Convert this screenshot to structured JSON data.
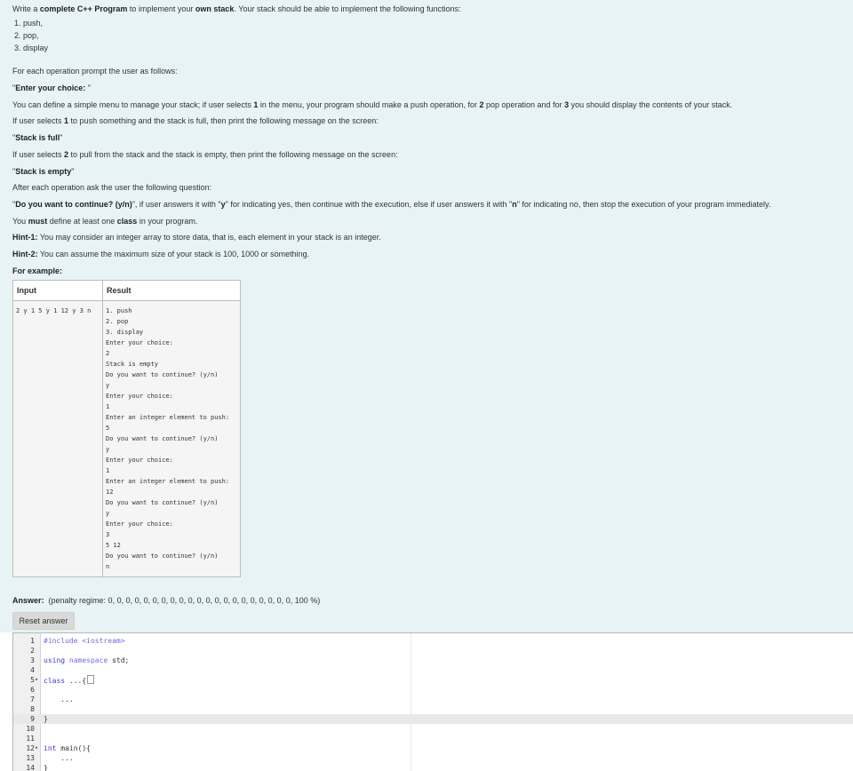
{
  "question": {
    "intro": {
      "pre": "Write a ",
      "b1": "complete C++ Program",
      "mid": " to implement your ",
      "b2": "own stack",
      "post": ". Your stack should be able to implement the following functions:"
    },
    "functions": [
      "1. push,",
      "2. pop,",
      "3. display"
    ],
    "prompt_line": "For each operation prompt the user as follows:",
    "enter_choice": {
      "q1": "\"",
      "b": "Enter your choice: ",
      "q2": "\""
    },
    "menu_desc": {
      "t1": "You can define a simple menu to manage your stack; if user selects ",
      "b1": "1",
      "t2": " in the menu, your program should make a push operation, for ",
      "b2": "2",
      "t3": " pop operation and for ",
      "b3": "3",
      "t4": " you should display the contents of your stack."
    },
    "full_cond": {
      "t1": "If user selects ",
      "b1": "1",
      "t2": " to push something and the stack is full, then print the following message on the screen:"
    },
    "full_msg": {
      "q1": "\"",
      "b": "Stack is full",
      "q2": "\""
    },
    "empty_cond": {
      "t1": "If user selects ",
      "b1": "2",
      "t2": " to pull from the stack and the stack is empty, then print the following message on the screen:"
    },
    "empty_msg": {
      "q1": "\"",
      "b": "Stack is empty",
      "q2": "\""
    },
    "after_op": "After each operation ask the user the following question:",
    "continue_q": {
      "q1": "\"",
      "b1": "Do you want to continue? (y/n)",
      "t1": "\", if user answers it with \"",
      "b2": "y",
      "t2": "\" for indicating yes, then continue with the execution, else if user answers it with \"",
      "b3": "n",
      "t3": "\" for indicating no, then stop the execution of your program immediately."
    },
    "class_req": {
      "t1": "You ",
      "b1": "must",
      "t2": " define at least one ",
      "b2": "class",
      "t3": " in your program."
    },
    "hint1": {
      "b": "Hint-1:",
      "t": " You may consider an integer array to store data, that is, each element in your stack is an integer."
    },
    "hint2": {
      "b": "Hint-2:",
      "t": " You can assume the maximum size of your stack is 100, 1000 or something."
    },
    "for_example": "For example:"
  },
  "example_table": {
    "headers": [
      "Input",
      "Result"
    ],
    "input": "2 y 1 5 y 1 12 y 3 n",
    "result_lines": [
      "1. push",
      "2. pop",
      "3. display",
      "Enter your choice:",
      "2",
      "Stack is empty",
      "Do you want to continue? (y/n)",
      "y",
      "Enter your choice:",
      "1",
      "Enter an integer element to push:",
      "5",
      "Do you want to continue? (y/n)",
      "y",
      "Enter your choice:",
      "1",
      "Enter an integer element to push:",
      "12",
      "Do you want to continue? (y/n)",
      "y",
      "Enter your choice:",
      "3",
      "5 12",
      "Do you want to continue? (y/n)",
      "n"
    ]
  },
  "answer": {
    "label_bold": "Answer:",
    "penalty": "(penalty regime: 0, 0, 0, 0, 0, 0, 0, 0, 0, 0, 0, 0, 0, 0, 0, 0, 0, 0, 0, 0, 0, 100 %)",
    "reset_label": "Reset answer"
  },
  "editor": {
    "lines": [
      {
        "n": "1",
        "fold": "",
        "code": "#include <iostream>",
        "style": "pre"
      },
      {
        "n": "2",
        "fold": "",
        "code": "",
        "style": ""
      },
      {
        "n": "3",
        "fold": "",
        "code": "using namespace std;",
        "style": "using"
      },
      {
        "n": "4",
        "fold": "",
        "code": "",
        "style": ""
      },
      {
        "n": "5",
        "fold": "▾",
        "code": "class ...{",
        "style": "class"
      },
      {
        "n": "6",
        "fold": "",
        "code": "",
        "style": ""
      },
      {
        "n": "7",
        "fold": "",
        "code": "    ...",
        "style": ""
      },
      {
        "n": "8",
        "fold": "",
        "code": "",
        "style": ""
      },
      {
        "n": "9",
        "fold": "",
        "code": "}",
        "style": "",
        "active": true
      },
      {
        "n": "10",
        "fold": "",
        "code": "",
        "style": ""
      },
      {
        "n": "11",
        "fold": "",
        "code": "",
        "style": ""
      },
      {
        "n": "12",
        "fold": "▾",
        "code": "int main(){",
        "style": "main"
      },
      {
        "n": "13",
        "fold": "",
        "code": "    ...",
        "style": ""
      },
      {
        "n": "14",
        "fold": "",
        "code": "}",
        "style": ""
      }
    ]
  }
}
